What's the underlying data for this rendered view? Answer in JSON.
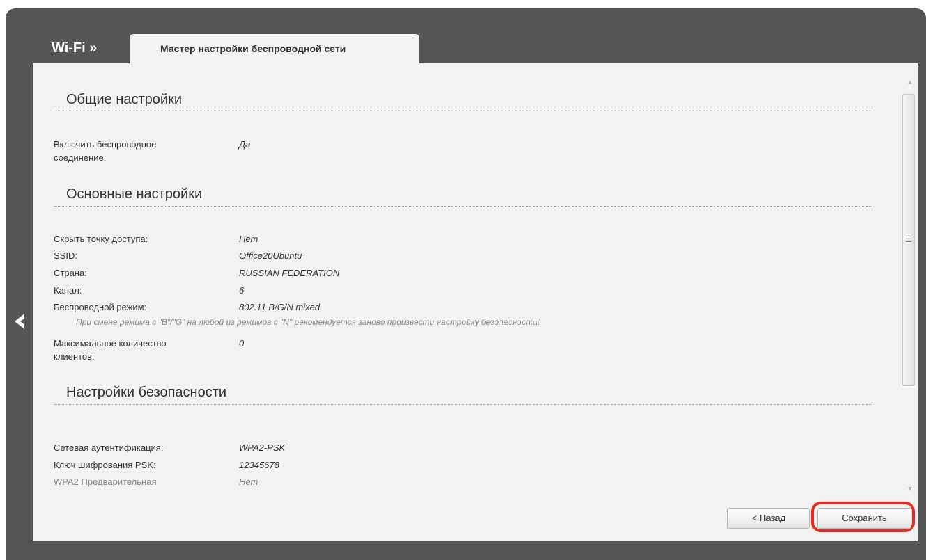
{
  "header": {
    "breadcrumb": "Wi-Fi »",
    "tab_label": "Мастер настройки беспроводной сети"
  },
  "sections": {
    "general": {
      "title": "Общие настройки",
      "rows": [
        {
          "label": "Включить беспроводное соединение:",
          "value": "Да"
        }
      ]
    },
    "basic": {
      "title": "Основные настройки",
      "rows": [
        {
          "label": "Скрыть точку доступа:",
          "value": "Нет"
        },
        {
          "label": "SSID:",
          "value": "Office20Ubuntu"
        },
        {
          "label": "Страна:",
          "value": "RUSSIAN FEDERATION"
        },
        {
          "label": "Канал:",
          "value": "6"
        },
        {
          "label": "Беспроводной режим:",
          "value": "802.11 B/G/N mixed"
        },
        {
          "label": "Максимальное количество клиентов:",
          "value": "0"
        }
      ],
      "hint": "При смене режима с \"B\"/\"G\" на любой из режимов с \"N\" рекомендуется заново произвести настройку безопасности!"
    },
    "security": {
      "title": "Настройки безопасности",
      "rows": [
        {
          "label": "Сетевая аутентификация:",
          "value": "WPA2-PSK"
        },
        {
          "label": "Ключ шифрования PSK:",
          "value": "12345678"
        },
        {
          "label": "WPA2 Предварительная",
          "value": "Нет"
        }
      ]
    }
  },
  "buttons": {
    "back": "< Назад",
    "save": "Сохранить"
  },
  "icons": {
    "nav_back": "chevron-left-icon",
    "scroll_grip": "scroll-grip-icon"
  },
  "colors": {
    "frame": "#555555",
    "panel": "#f2f2f2",
    "highlight": "#e8291b"
  }
}
